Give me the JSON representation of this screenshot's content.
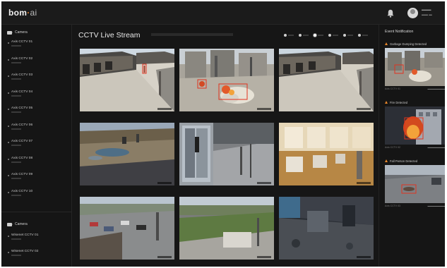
{
  "header": {
    "logo_main": "bom",
    "logo_dot": "·",
    "logo_ai": "ai",
    "icons": {
      "notification": "bell-icon",
      "profile": "avatar"
    }
  },
  "sidebar": {
    "section1_title": "Camera",
    "cameras": [
      {
        "label": "Axis CCTV 01"
      },
      {
        "label": "Axis CCTV 02"
      },
      {
        "label": "Axis CCTV 03"
      },
      {
        "label": "Axis CCTV 04"
      },
      {
        "label": "Axis CCTV 05"
      },
      {
        "label": "Axis CCTV 06"
      },
      {
        "label": "Axis CCTV 07"
      },
      {
        "label": "Axis CCTV 08"
      },
      {
        "label": "Axis CCTV 09"
      },
      {
        "label": "Axis CCTV 10"
      }
    ],
    "section2_title": "Camera",
    "cameras2": [
      {
        "label": "Wisenet CCTV 01"
      },
      {
        "label": "Wisenet CCTV 02"
      }
    ]
  },
  "main": {
    "title": "CCTV Live Stream",
    "pager": {
      "count": 6,
      "active_index": 2
    },
    "feeds": [
      {
        "scene": "courtyard",
        "detection": "person"
      },
      {
        "scene": "construction-debris",
        "detection": "fire-smoke"
      },
      {
        "scene": "courtyard"
      },
      {
        "scene": "fountain-park"
      },
      {
        "scene": "office-glass-door"
      },
      {
        "scene": "interior-gallery"
      },
      {
        "scene": "parking-lot"
      },
      {
        "scene": "campus-walkway"
      },
      {
        "scene": "plaza-night"
      }
    ]
  },
  "events": {
    "title": "Event Notification",
    "items": [
      {
        "label": "Garbage Dumping Detected",
        "camera": "Axis CCTV 01"
      },
      {
        "label": "Fire Detected",
        "camera": "Axis CCTV 02"
      },
      {
        "label": "Fall Person Detected",
        "camera": "Axis CCTV 03"
      }
    ]
  },
  "colors": {
    "background": "#161616",
    "accent": "#e8862a",
    "detection": "#e03b2a"
  }
}
